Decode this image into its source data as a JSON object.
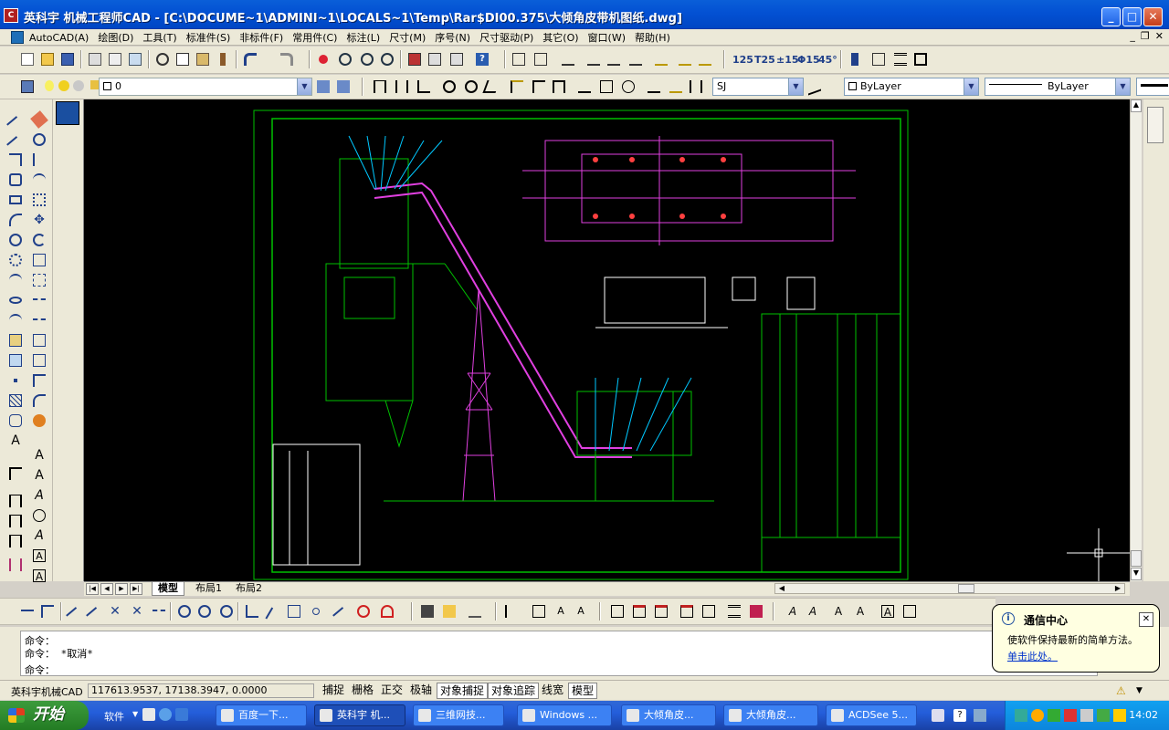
{
  "window": {
    "title": "英科宇 机械工程师CAD - [C:\\DOCUME~1\\ADMINI~1\\LOCALS~1\\Temp\\Rar$DI00.375\\大倾角皮带机图纸.dwg]",
    "minimize": "_",
    "maximize": "□",
    "close": "✕"
  },
  "menu": {
    "items": [
      "AutoCAD(A)",
      "绘图(D)",
      "工具(T)",
      "标准件(S)",
      "非标件(F)",
      "常用件(C)",
      "标注(L)",
      "尺寸(M)",
      "序号(N)",
      "尺寸驱动(P)",
      "其它(O)",
      "窗口(W)",
      "帮助(H)"
    ],
    "mdi": [
      "_",
      "❐",
      "✕"
    ]
  },
  "layer_toolbar": {
    "layer_value": "0",
    "text_style": "SJ",
    "color_value": "ByLayer",
    "linetype_value": "ByLayer"
  },
  "dim_toolbar": {
    "labels": [
      "125",
      "T25",
      "±15",
      "Φ15",
      "45°"
    ]
  },
  "canvas": {
    "background": "#000000",
    "drawing_color": "#00c000"
  },
  "tabs": {
    "items": [
      "模型",
      "布局1",
      "布局2"
    ],
    "active": "模型"
  },
  "command": {
    "lines": [
      "命令：",
      "命令：  *取消*",
      "命令："
    ]
  },
  "status": {
    "app_name": "英科宇机械CAD",
    "coords": "117613.9537, 17138.3947, 0.0000",
    "toggles": [
      {
        "label": "捕捉",
        "on": false
      },
      {
        "label": "栅格",
        "on": false
      },
      {
        "label": "正交",
        "on": false
      },
      {
        "label": "极轴",
        "on": false
      },
      {
        "label": "对象捕捉",
        "on": true
      },
      {
        "label": "对象追踪",
        "on": true
      },
      {
        "label": "线宽",
        "on": false
      },
      {
        "label": "模型",
        "on": true
      }
    ]
  },
  "balloon": {
    "title": "通信中心",
    "body": "使软件保持最新的简单方法。",
    "link": "单击此处。"
  },
  "taskbar": {
    "start": "开始",
    "quicklaunch_label": "软件",
    "tasks": [
      {
        "label": "百度一下...",
        "active": false
      },
      {
        "label": "英科宇 机...",
        "active": true
      },
      {
        "label": "三维网技...",
        "active": false
      },
      {
        "label": "Windows ...",
        "active": false
      },
      {
        "label": "大倾角皮...",
        "active": false
      },
      {
        "label": "大倾角皮...",
        "active": false
      },
      {
        "label": "ACDSee 5...",
        "active": false
      }
    ],
    "clock": "14:02"
  }
}
